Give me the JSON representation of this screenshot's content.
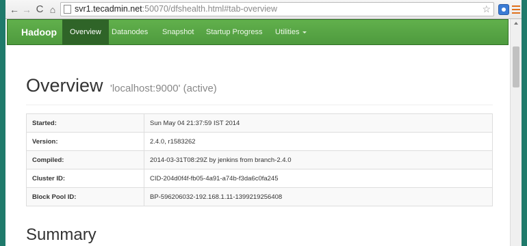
{
  "browser": {
    "url_host": "svr1.tecadmin.net",
    "url_path": ":50070/dfshealth.html#tab-overview",
    "back_glyph": "←",
    "forward_glyph": "→",
    "reload_glyph": "C",
    "home_glyph": "⌂",
    "star_glyph": "☆"
  },
  "navbar": {
    "brand": "Hadoop",
    "items": [
      {
        "label": "Overview",
        "active": true
      },
      {
        "label": "Datanodes"
      },
      {
        "label": "Snapshot"
      },
      {
        "label": "Startup Progress"
      },
      {
        "label": "Utilities",
        "has_dropdown": true
      }
    ]
  },
  "overview": {
    "title": "Overview",
    "subtitle": "'localhost:9000' (active)",
    "rows": [
      {
        "key": "Started:",
        "value": "Sun May 04 21:37:59 IST 2014"
      },
      {
        "key": "Version:",
        "value": "2.4.0, r1583262"
      },
      {
        "key": "Compiled:",
        "value": "2014-03-31T08:29Z by jenkins from branch-2.4.0"
      },
      {
        "key": "Cluster ID:",
        "value": "CID-204d0f4f-fb05-4a91-a74b-f3da6c0fa245"
      },
      {
        "key": "Block Pool ID:",
        "value": "BP-596206032-192.168.1.11-1399219256408"
      }
    ]
  },
  "summary": {
    "title": "Summary"
  },
  "colors": {
    "navbar_green": "#4e9a3e",
    "navbar_active": "#2f6428",
    "desktop_teal": "#1f7a6b"
  }
}
